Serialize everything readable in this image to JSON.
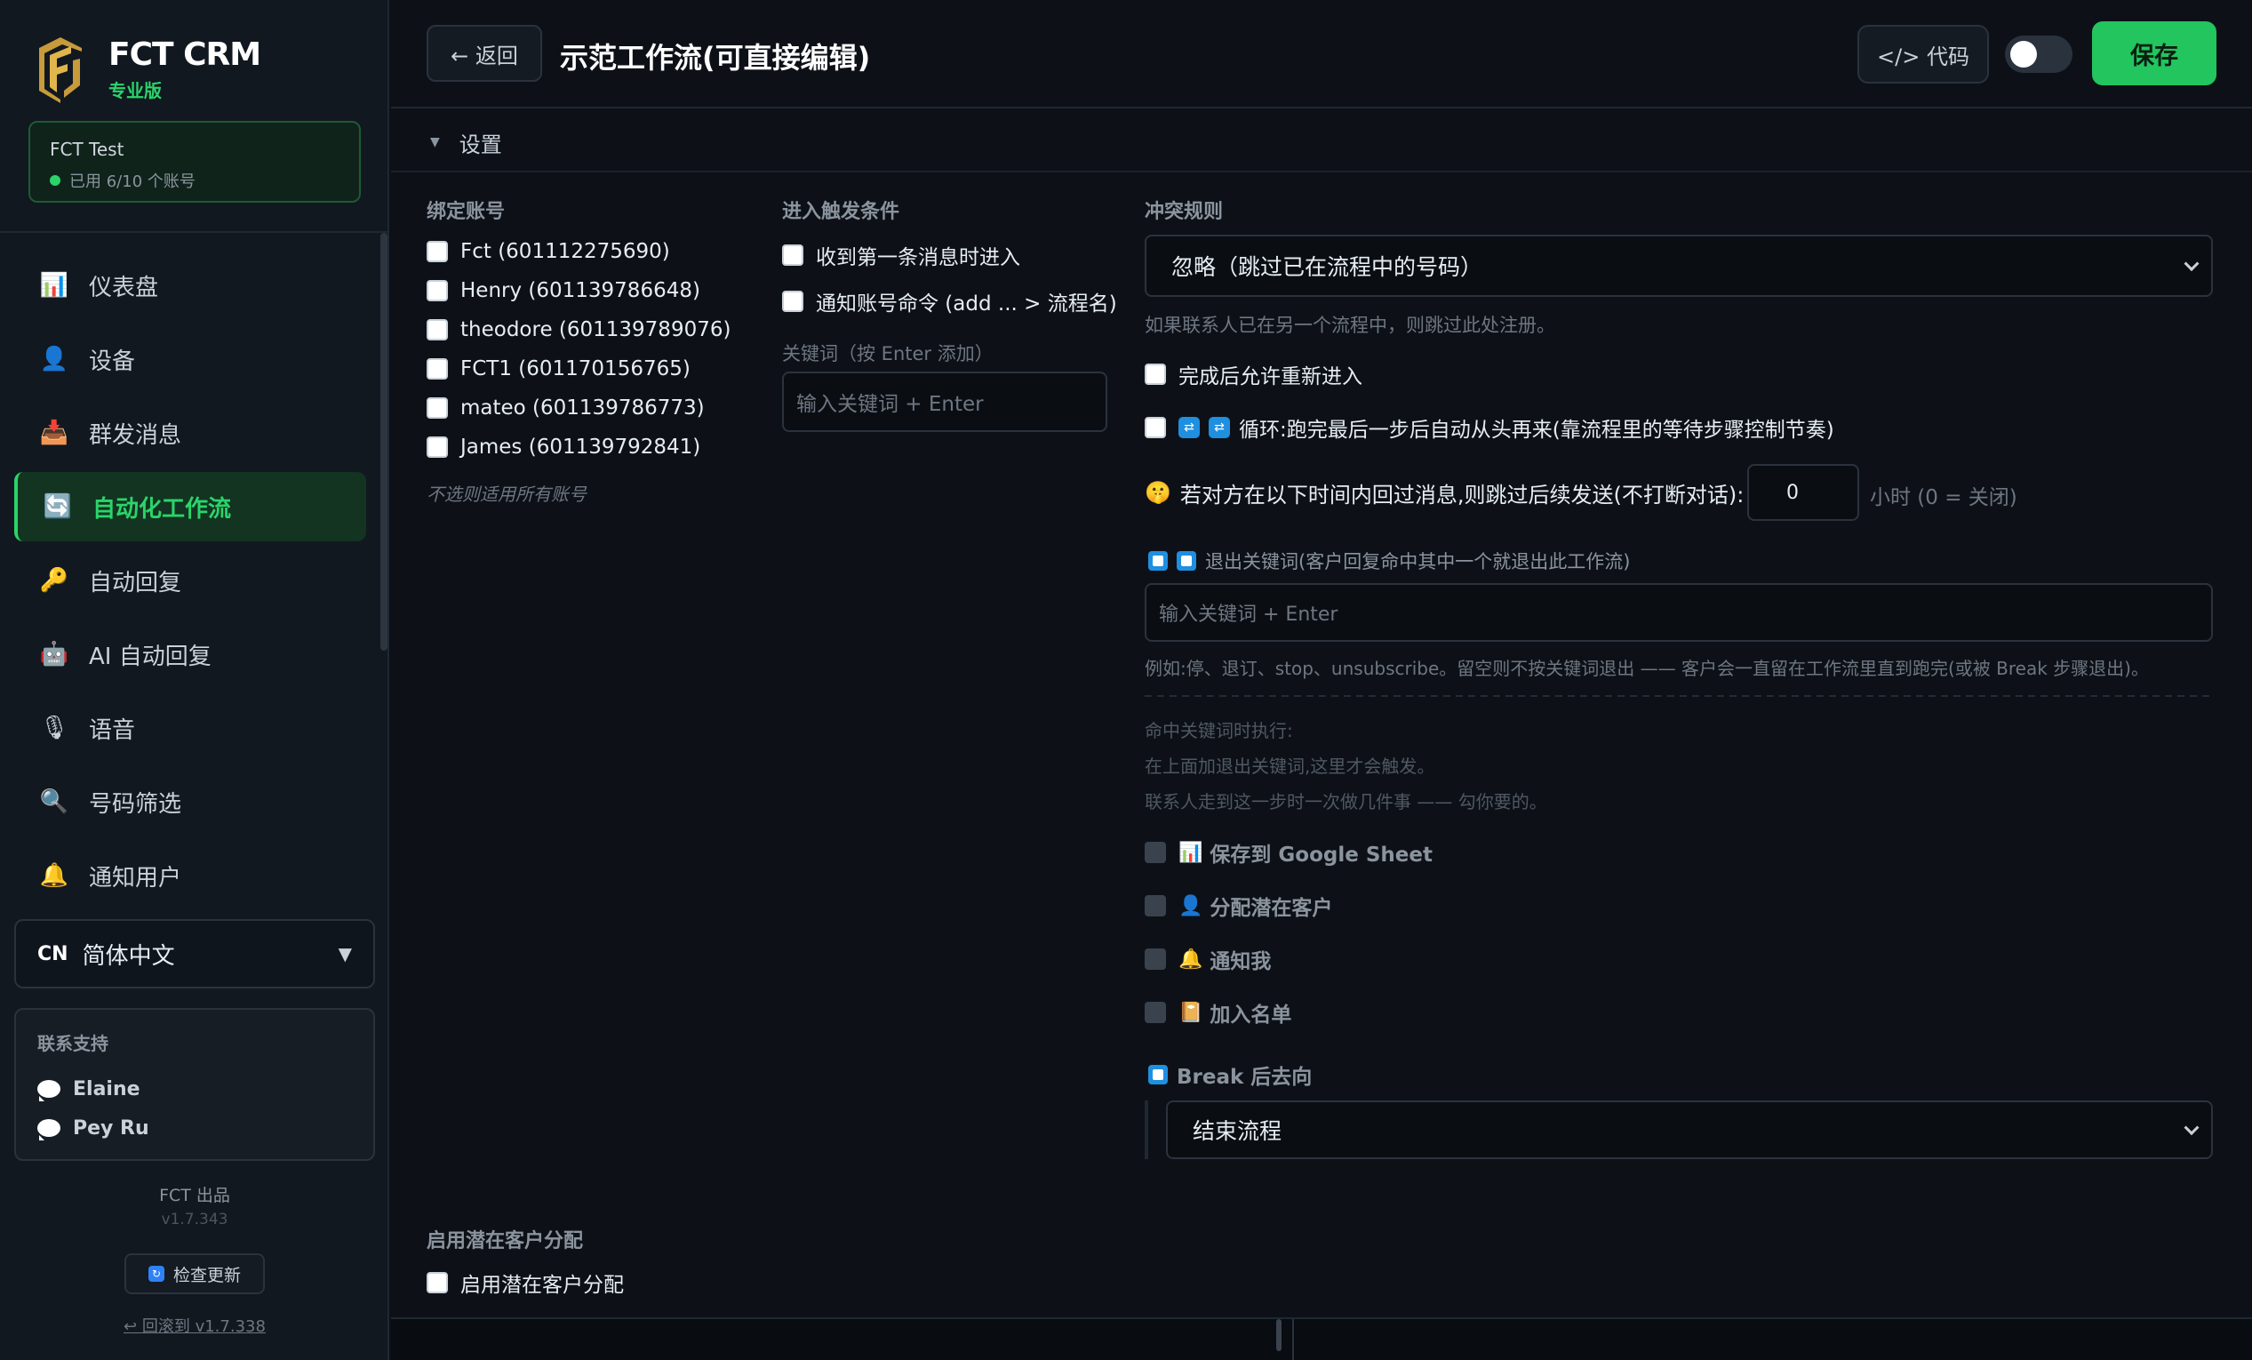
{
  "brand": {
    "title": "FCT CRM",
    "edition": "专业版"
  },
  "account": {
    "name": "FCT Test",
    "usage": "已用 6/10 个账号"
  },
  "nav": [
    {
      "label": "仪表盘",
      "icon": "chart-icon"
    },
    {
      "label": "设备",
      "icon": "person-icon"
    },
    {
      "label": "群发消息",
      "icon": "inbox-icon"
    },
    {
      "label": "自动化工作流",
      "icon": "refresh-icon"
    },
    {
      "label": "自动回复",
      "icon": "key-icon"
    },
    {
      "label": "AI 自动回复",
      "icon": "robot-icon"
    },
    {
      "label": "语音",
      "icon": "microphone-icon"
    },
    {
      "label": "号码筛选",
      "icon": "magnifier-icon"
    },
    {
      "label": "通知用户",
      "icon": "bell-icon"
    }
  ],
  "language": {
    "code": "CN",
    "name": "简体中文"
  },
  "support": {
    "title": "联系支持",
    "contacts": [
      "Elaine",
      "Pey Ru"
    ]
  },
  "footer": {
    "brand": "FCT 出品",
    "version": "v1.7.343",
    "check_update": "检查更新",
    "rollback": "↩ 回滚到 v1.7.338"
  },
  "topbar": {
    "back": "← 返回",
    "title": "示范工作流(可直接编辑)",
    "code": "</> 代码",
    "save": "保存"
  },
  "settings": {
    "header": "设置",
    "bind": {
      "title": "绑定账号",
      "accounts": [
        "Fct (601112275690)",
        "Henry (601139786648)",
        "theodore (601139789076)",
        "FCT1 (601170156765)",
        "mateo (601139786773)",
        "James (601139792841)"
      ],
      "hint": "不选则适用所有账号"
    },
    "trigger": {
      "title": "进入触发条件",
      "options": [
        "收到第一条消息时进入",
        "通知账号命令 (add ... > 流程名)"
      ],
      "keyword_label": "关键词（按 Enter 添加）",
      "keyword_placeholder": "输入关键词 + Enter"
    },
    "conflict": {
      "title": "冲突规则",
      "selected": "忽略（跳过已在流程中的号码）",
      "hint": "如果联系人已在另一个流程中，则跳过此处注册。",
      "allow_reenter": "完成后允许重新进入",
      "loop": "循环:跑完最后一步后自动从头再来(靠流程里的等待步骤控制节奏)",
      "skip_reply_label": "若对方在以下时间内回过消息,则跳过后续发送(不打断对话):",
      "skip_reply_value": "0",
      "skip_reply_unit": "小时 (0 = 关闭)",
      "exit_label": "退出关键词(客户回复命中其中一个就退出此工作流)",
      "exit_placeholder": "输入关键词 + Enter",
      "exit_hint": "例如:停、退订、stop、unsubscribe。留空则不按关键词退出 —— 客户会一直留在工作流里直到跑完(或被 Break 步骤退出)。",
      "on_hit_lines": [
        "命中关键词时执行:",
        "在上面加退出关键词,这里才会触发。",
        "联系人走到这一步时一次做几件事 —— 勾你要的。"
      ],
      "actions": [
        {
          "label": "保存到 Google Sheet",
          "icon": "chart-icon"
        },
        {
          "label": "分配潜在客户",
          "icon": "person-icon"
        },
        {
          "label": "通知我",
          "icon": "bell-icon"
        },
        {
          "label": "加入名单",
          "icon": "notebook-icon"
        }
      ],
      "break_label": "Break 后去向",
      "break_selected": "结束流程"
    },
    "lead": {
      "title": "启用潜在客户分配",
      "option": "启用潜在客户分配"
    }
  },
  "colors": {
    "accent": "#22c55e",
    "background": "#0d1117",
    "sidebar": "#111820"
  }
}
